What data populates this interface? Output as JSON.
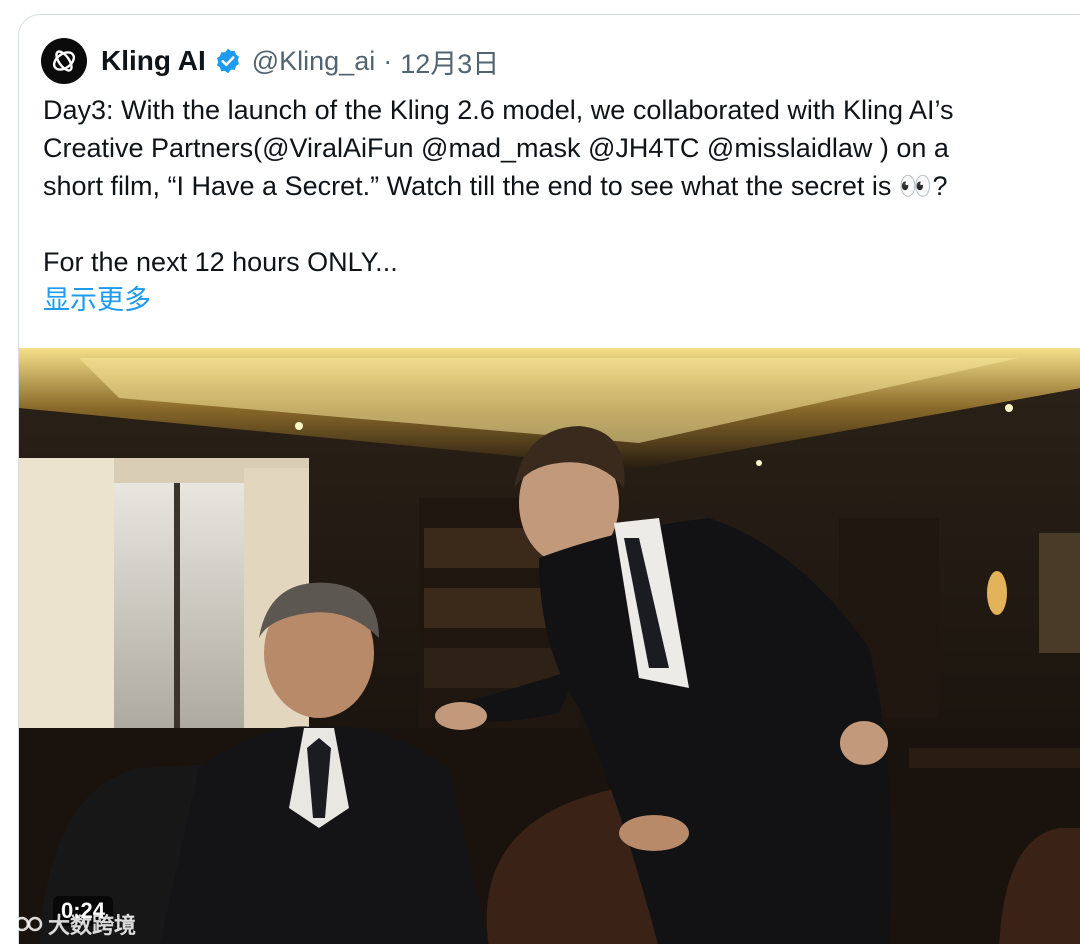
{
  "tweet": {
    "author_name": "Kling AI",
    "handle": "@Kling_ai",
    "separator": "·",
    "date": "12月3日",
    "text_lines": [
      "Day3: With the launch of the Kling 2.6 model, we collaborated with Kling AI’s",
      "Creative Partners(@ViralAiFun  @mad_mask  @JH4TC  @misslaidlaw ) on a",
      "short film, “I Have a Secret.” Watch till the end to see what the secret is 👀?"
    ],
    "text_line_2": "For the next 12 hours ONLY...",
    "show_more": "显示更多"
  },
  "media": {
    "duration": "0:24"
  },
  "watermark": {
    "text": "大数跨境"
  },
  "colors": {
    "link": "#1d9bf0",
    "verified": "#1d9bf0",
    "text": "#0f1419",
    "muted": "#536471"
  }
}
